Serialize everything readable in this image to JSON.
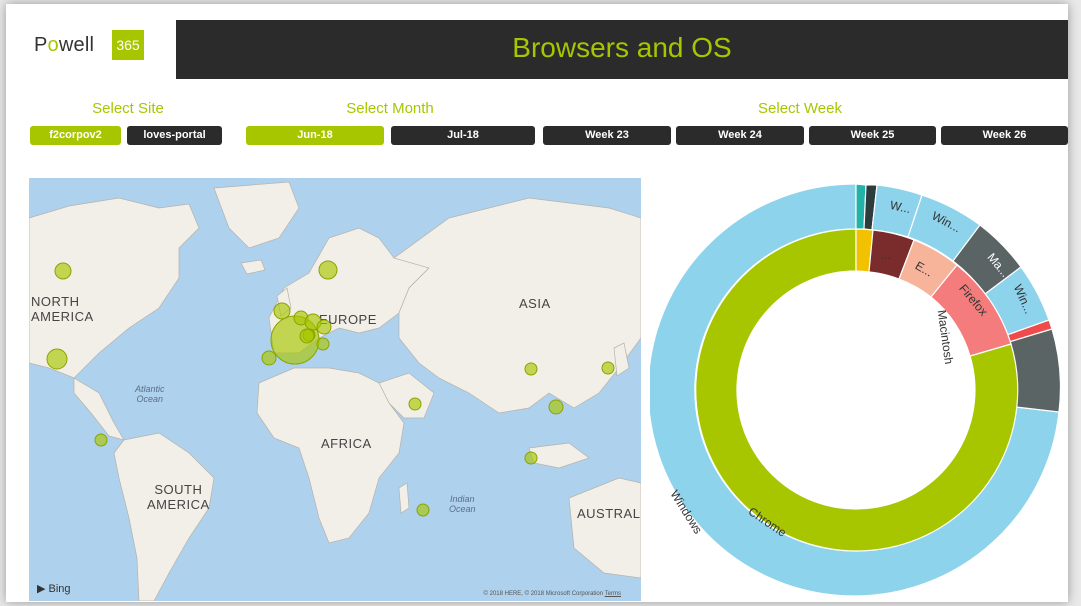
{
  "header": {
    "logo_text": "Powell",
    "logo_badge": "365",
    "title": "Browsers and OS"
  },
  "slicers": {
    "site": {
      "label": "Select Site",
      "options": [
        "f2corpov2",
        "loves-portal"
      ],
      "selected": "f2corpov2"
    },
    "month": {
      "label": "Select Month",
      "options": [
        "Jun-18",
        "Jul-18"
      ],
      "selected": "Jun-18"
    },
    "week": {
      "label": "Select Week",
      "options": [
        "Week 23",
        "Week 24",
        "Week 25",
        "Week 26"
      ]
    }
  },
  "map": {
    "labels": {
      "north_america": "NORTH\nAMERICA",
      "europe": "EUROPE",
      "asia": "ASIA",
      "africa": "AFRICA",
      "south_america": "SOUTH\nAMERICA",
      "australia": "AUSTRAL"
    },
    "oceans": {
      "atlantic": "Atlantic\nOcean",
      "indian": "Indian\nOcean"
    },
    "provider": "Bing",
    "copyright": "© 2018 HERE, © 2018 Microsoft Corporation",
    "terms": "Terms",
    "bubble_color": "#a8c600"
  },
  "sunburst": {
    "inner_labels": {
      "chrome": "Chrome",
      "ellipsis": "...",
      "e": "E...",
      "firefox": "Firefox"
    },
    "outer_labels": {
      "windows": "Windows",
      "macintosh": "Macintosh",
      "w1": "W...",
      "w2": "Win...",
      "ma": "Ma...",
      "w3": "Win..."
    },
    "colors": {
      "chrome": "#a8c600",
      "windows": "#8dd3ec",
      "macintosh": "#5a6464",
      "firefox": "#f47c7c",
      "edge": "#f7b49b",
      "ie": "#7a2b2b",
      "other": "#f2c200",
      "teal": "#22b2aa",
      "dark": "#2d3c3c"
    }
  }
}
